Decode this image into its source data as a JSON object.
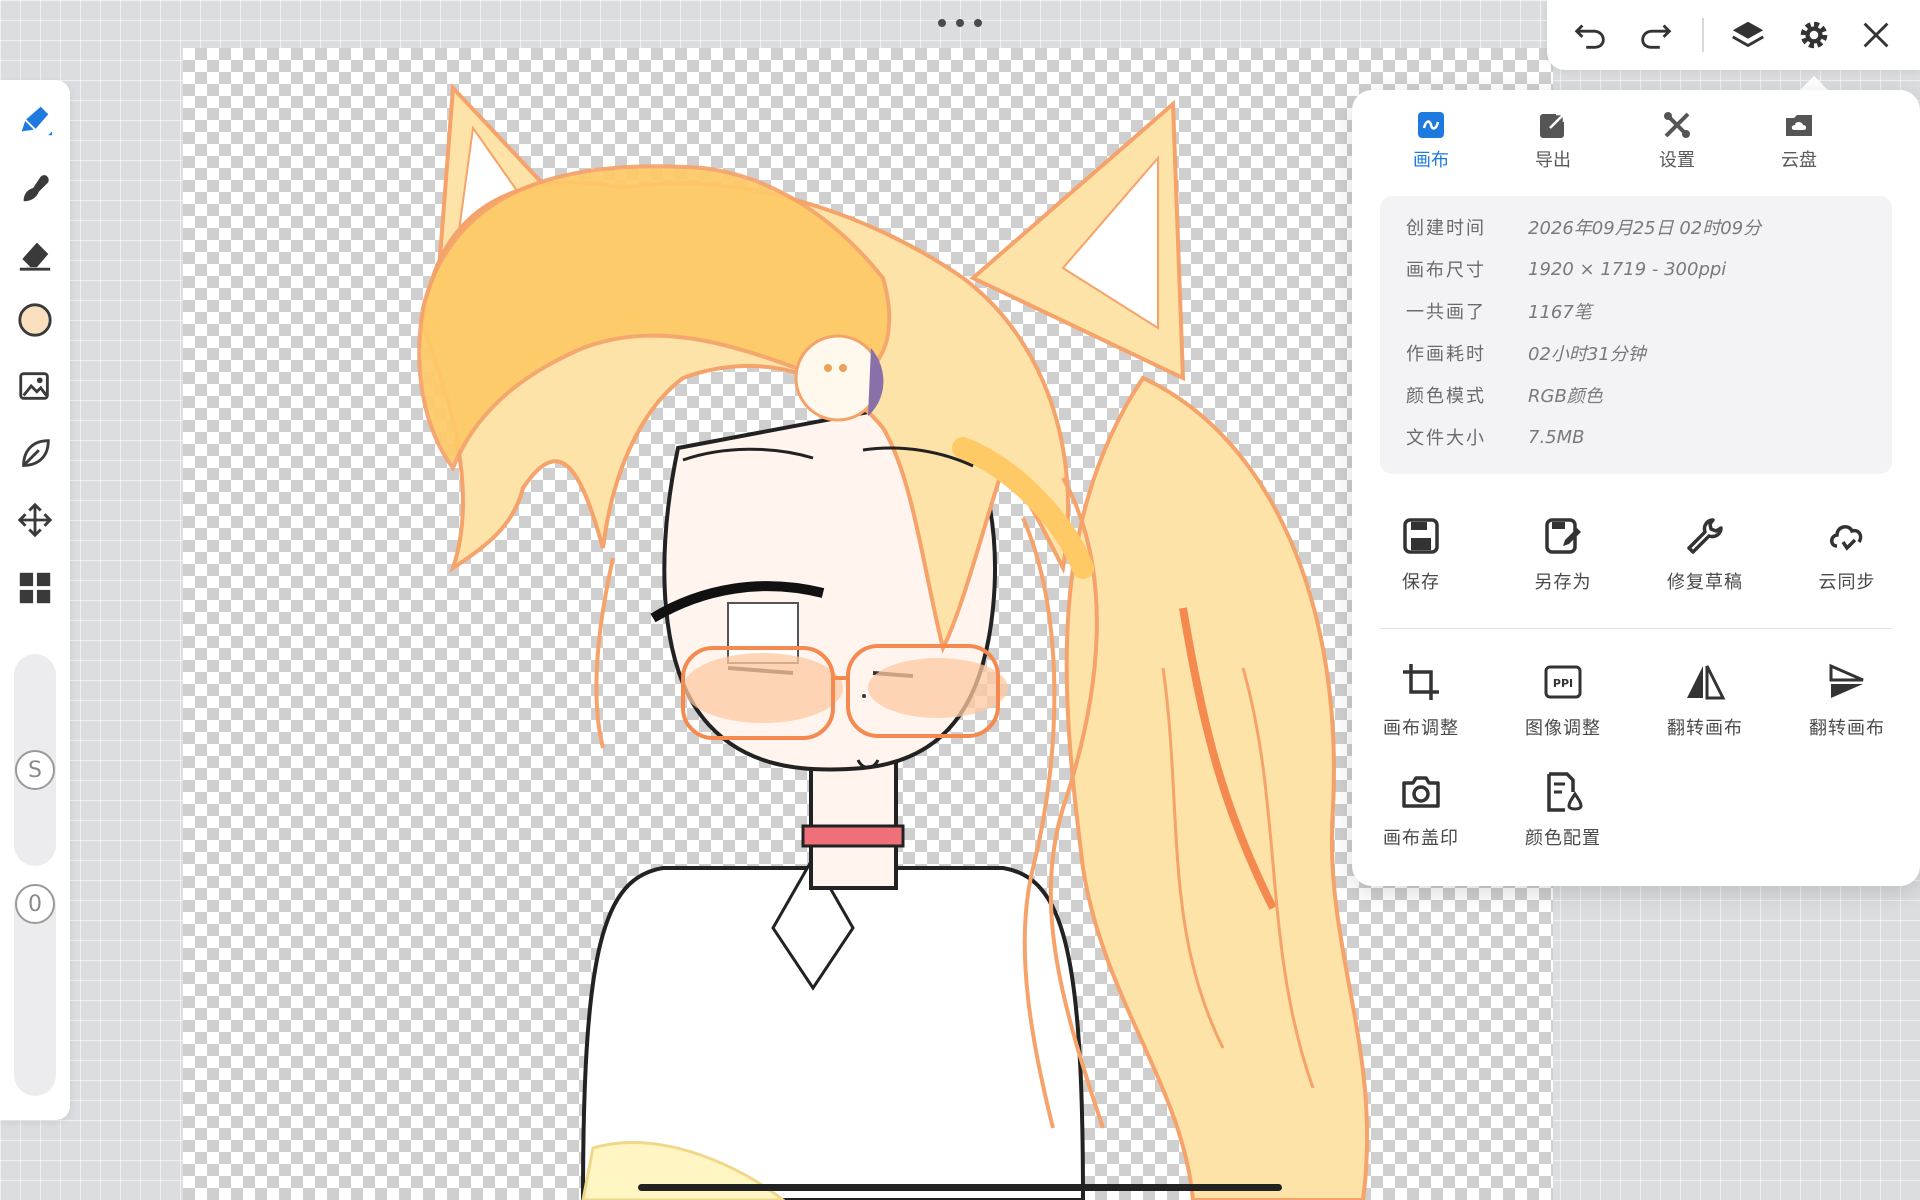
{
  "canvas": {
    "background": "transparent-checkerboard"
  },
  "toolbar_left": {
    "tools": [
      {
        "id": "brush",
        "icon": "pen-brush-icon",
        "active": true
      },
      {
        "id": "smudge",
        "icon": "smudge-icon"
      },
      {
        "id": "eraser",
        "icon": "eraser-icon"
      },
      {
        "id": "color",
        "icon": "color-swatch-icon",
        "color": "#fbe0c0"
      },
      {
        "id": "image",
        "icon": "image-adjust-icon"
      },
      {
        "id": "lasso",
        "icon": "lasso-leaf-icon"
      },
      {
        "id": "move",
        "icon": "move-arrows-icon"
      },
      {
        "id": "grid",
        "icon": "grid-tiles-icon"
      }
    ],
    "size_slider": {
      "badge": "S"
    },
    "opacity_slider": {
      "badge": "0"
    }
  },
  "toolbar_top": {
    "more_icon": "more-dots-icon",
    "buttons": [
      "undo-icon",
      "redo-icon",
      "layers-icon",
      "gear-icon",
      "close-icon"
    ]
  },
  "panel": {
    "tabs": [
      {
        "label": "画布",
        "icon": "canvas-tab-icon",
        "active": true
      },
      {
        "label": "导出",
        "icon": "export-icon"
      },
      {
        "label": "设置",
        "icon": "tools-icon"
      },
      {
        "label": "云盘",
        "icon": "cloud-folder-icon"
      }
    ],
    "info": [
      {
        "label": "创建时间",
        "value": "2026年09月25日 02时09分"
      },
      {
        "label": "画布尺寸",
        "value": "1920 × 1719 - 300ppi"
      },
      {
        "label": "一共画了",
        "value": "1167笔"
      },
      {
        "label": "作画耗时",
        "value": "02小时31分钟"
      },
      {
        "label": "颜色模式",
        "value": "RGB颜色"
      },
      {
        "label": "文件大小",
        "value": "7.5MB"
      }
    ],
    "actions_row1": [
      {
        "label": "保存",
        "icon": "save-icon"
      },
      {
        "label": "另存为",
        "icon": "save-as-icon"
      },
      {
        "label": "修复草稿",
        "icon": "wrench-icon"
      },
      {
        "label": "云同步",
        "icon": "cloud-sync-icon"
      }
    ],
    "actions_row2": [
      {
        "label": "画布调整",
        "icon": "crop-icon"
      },
      {
        "label": "图像调整",
        "icon": "ppi-icon",
        "icon_text": "PPI"
      },
      {
        "label": "翻转画布",
        "icon": "flip-horizontal-icon"
      },
      {
        "label": "翻转画布",
        "icon": "flip-vertical-icon"
      }
    ],
    "actions_row3": [
      {
        "label": "画布盖印",
        "icon": "camera-icon"
      },
      {
        "label": "颜色配置",
        "icon": "color-profile-icon"
      }
    ]
  },
  "colors": {
    "accent": "#1f7ae0",
    "hair": "#fde5b0",
    "hair_outline": "#f5a36a",
    "skin": "#fff4ee",
    "collar": "#f0707a"
  }
}
